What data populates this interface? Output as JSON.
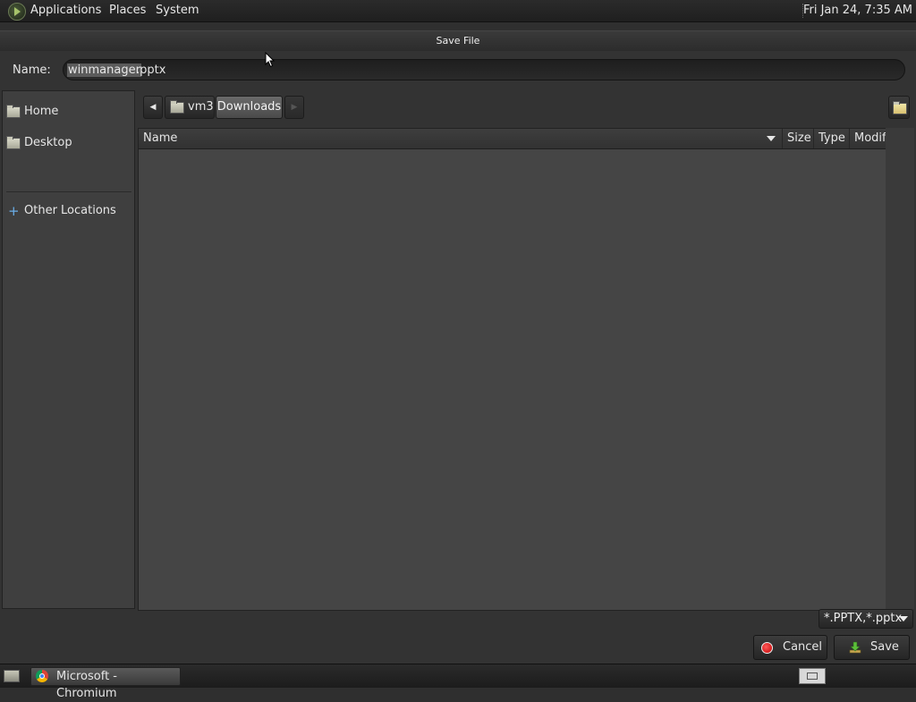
{
  "top_panel": {
    "menus": [
      "Applications",
      "Places",
      "System"
    ],
    "clock": "Fri Jan 24,  7:35 AM"
  },
  "dialog": {
    "title": "Save File",
    "name_label": "Name:",
    "name_value": "winmanager.pptx",
    "name_selected": "winmanager",
    "name_extension": ".pptx",
    "sidebar": {
      "items": [
        {
          "label": "Home",
          "icon": "home-folder-icon"
        },
        {
          "label": "Desktop",
          "icon": "desktop-folder-icon"
        },
        {
          "label": "Other Locations",
          "icon": "plus-icon"
        }
      ]
    },
    "pathbar": {
      "segments": [
        "vm3",
        "Downloads"
      ],
      "active": "Downloads"
    },
    "file_list": {
      "columns": [
        "Name",
        "Size",
        "Type",
        "Modif"
      ],
      "sort_column": "Name",
      "rows": []
    },
    "filter": "*.PPTX,*.pptx",
    "buttons": {
      "cancel": "Cancel",
      "save": "Save"
    }
  },
  "taskbar": {
    "window_button": "Microsoft - Chromium"
  }
}
